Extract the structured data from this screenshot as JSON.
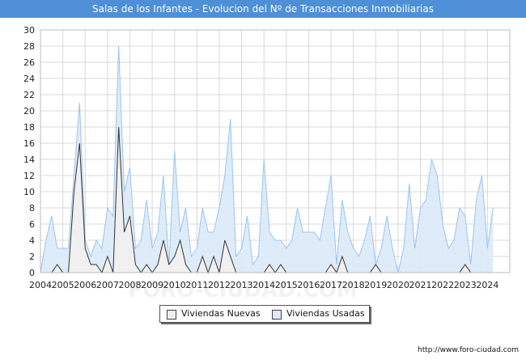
{
  "title": "Salas de los Infantes - Evolucion del Nº de Transacciones Inmobiliarias",
  "footer": {
    "url": "http://www.foro-ciudad.com"
  },
  "watermark": "FORO-CIUDAD.COM",
  "colors": {
    "title_bar": "#4e8fd6",
    "nuevas_fill": "#f0f0f0",
    "nuevas_line": "#333333",
    "usadas_fill": "#dceaf9",
    "usadas_line": "#9cc4ef",
    "grid": "#d8d8d8"
  },
  "legend": {
    "nuevas_label": "Viviendas Nuevas",
    "usadas_label": "Viviendas Usadas"
  },
  "chart_data": {
    "type": "area",
    "title": "Salas de los Infantes - Evolucion del Nº de Transacciones Inmobiliarias",
    "xlabel": "",
    "ylabel": "",
    "ylim": [
      0,
      30
    ],
    "yticks": [
      0,
      2,
      4,
      6,
      8,
      10,
      12,
      14,
      16,
      18,
      20,
      22,
      24,
      26,
      28,
      30
    ],
    "xticks": [
      "2004",
      "2005",
      "2006",
      "2007",
      "2008",
      "2009",
      "2010",
      "2011",
      "2012",
      "2013",
      "2014",
      "2015",
      "2016",
      "2017",
      "2018",
      "2019",
      "2020",
      "2021",
      "2022",
      "2023",
      "2024"
    ],
    "grid": true,
    "legend_position": "bottom-center",
    "x_frequency": "quarterly",
    "x_start": "2004",
    "series": [
      {
        "name": "Viviendas Nuevas",
        "values": [
          0,
          0,
          0,
          1,
          0,
          0,
          10,
          16,
          3,
          1,
          1,
          0,
          2,
          0,
          18,
          5,
          7,
          1,
          0,
          1,
          0,
          1,
          4,
          1,
          2,
          4,
          1,
          0,
          0,
          2,
          0,
          2,
          0,
          4,
          2,
          0,
          0,
          0,
          0,
          0,
          0,
          1,
          0,
          1,
          0,
          0,
          0,
          0,
          0,
          0,
          0,
          0,
          1,
          0,
          2,
          0,
          0,
          0,
          0,
          0,
          1,
          0,
          0,
          0,
          0,
          0,
          0,
          0,
          0,
          0,
          0,
          0,
          0,
          0,
          0,
          0,
          1,
          0,
          0,
          0,
          0,
          0
        ]
      },
      {
        "name": "Viviendas Usadas",
        "values": [
          0,
          4,
          7,
          3,
          3,
          3,
          12,
          21,
          4,
          2,
          4,
          3,
          8,
          7,
          28,
          10,
          13,
          3,
          4,
          9,
          3,
          5,
          12,
          1,
          15,
          5,
          8,
          2,
          3,
          8,
          5,
          5,
          8,
          12,
          19,
          2,
          3,
          7,
          1,
          2,
          14,
          5,
          4,
          4,
          3,
          4,
          8,
          5,
          5,
          5,
          4,
          8,
          12,
          1,
          9,
          5,
          3,
          2,
          4,
          7,
          1,
          3,
          7,
          3,
          0,
          3,
          11,
          3,
          8,
          9,
          14,
          12,
          6,
          3,
          4,
          8,
          7,
          1,
          9,
          12,
          3,
          8
        ]
      }
    ]
  }
}
